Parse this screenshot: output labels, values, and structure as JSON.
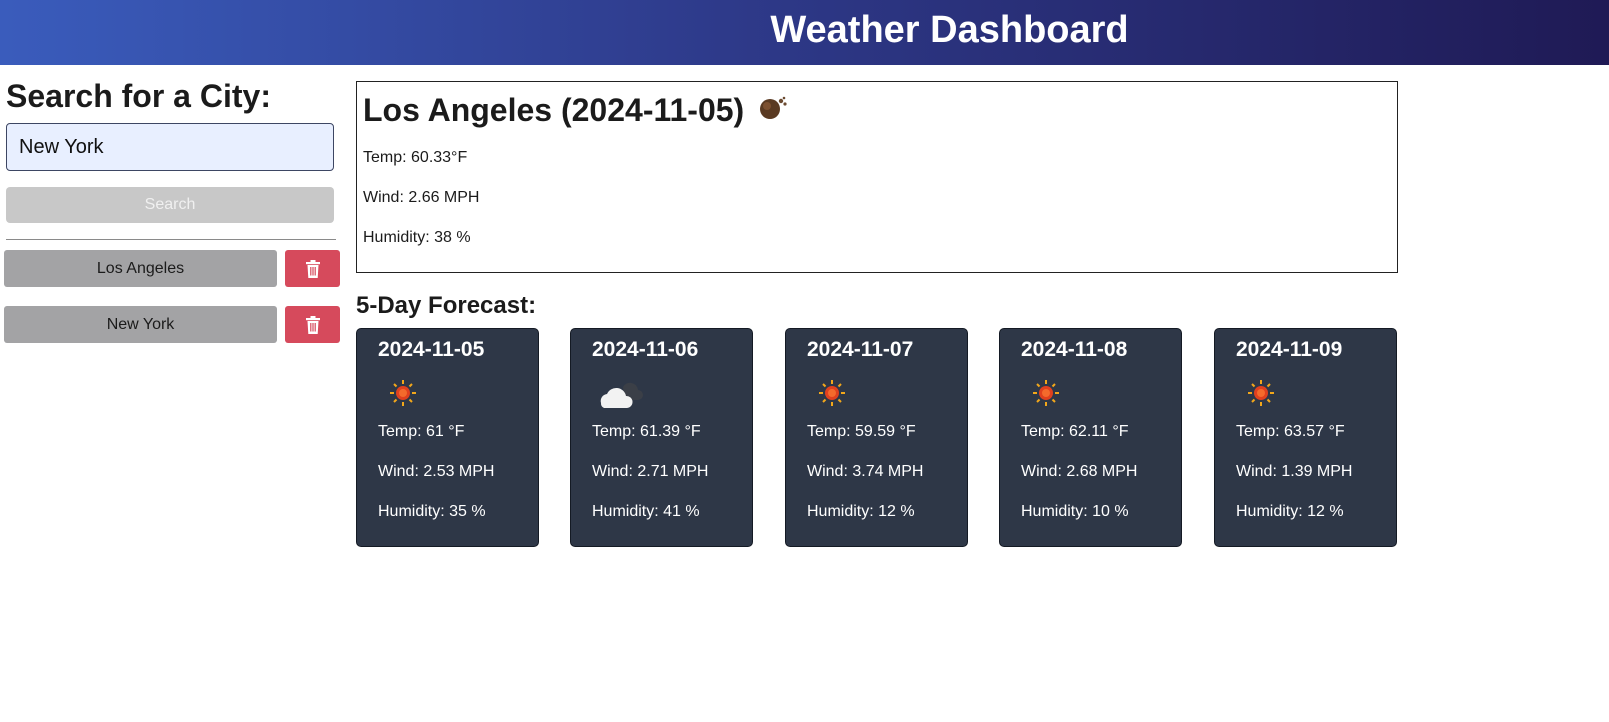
{
  "header": {
    "title": "Weather Dashboard"
  },
  "search": {
    "heading": "Search for a City:",
    "input_value": "New York",
    "button_label": "Search"
  },
  "history": [
    {
      "city": "Los Angeles",
      "delete_icon": "trash-icon"
    },
    {
      "city": "New York",
      "delete_icon": "trash-icon"
    }
  ],
  "current": {
    "title": "Los Angeles (2024-11-05)",
    "icon": "smoke-haze-icon",
    "temp": "Temp: 60.33°F",
    "wind": "Wind: 2.66 MPH",
    "humidity": "Humidity: 38 %"
  },
  "forecast": {
    "heading": "5-Day Forecast:",
    "days": [
      {
        "date": "2024-11-05",
        "icon": "sun-icon",
        "temp": "Temp: 61 °F",
        "wind": "Wind: 2.53 MPH",
        "humidity": "Humidity: 35 %"
      },
      {
        "date": "2024-11-06",
        "icon": "cloud-icon",
        "temp": "Temp: 61.39 °F",
        "wind": "Wind: 2.71 MPH",
        "humidity": "Humidity: 41 %"
      },
      {
        "date": "2024-11-07",
        "icon": "sun-icon",
        "temp": "Temp: 59.59 °F",
        "wind": "Wind: 3.74 MPH",
        "humidity": "Humidity: 12 %"
      },
      {
        "date": "2024-11-08",
        "icon": "sun-icon",
        "temp": "Temp: 62.11 °F",
        "wind": "Wind: 2.68 MPH",
        "humidity": "Humidity: 10 %"
      },
      {
        "date": "2024-11-09",
        "icon": "sun-icon",
        "temp": "Temp: 63.57 °F",
        "wind": "Wind: 1.39 MPH",
        "humidity": "Humidity: 12 %"
      }
    ]
  },
  "colors": {
    "header_start": "#3a5cbc",
    "header_end": "#1f1a55",
    "card_bg": "#2e3747",
    "delete_red": "#d64a5c",
    "city_button_gray": "#a3a3a5"
  }
}
